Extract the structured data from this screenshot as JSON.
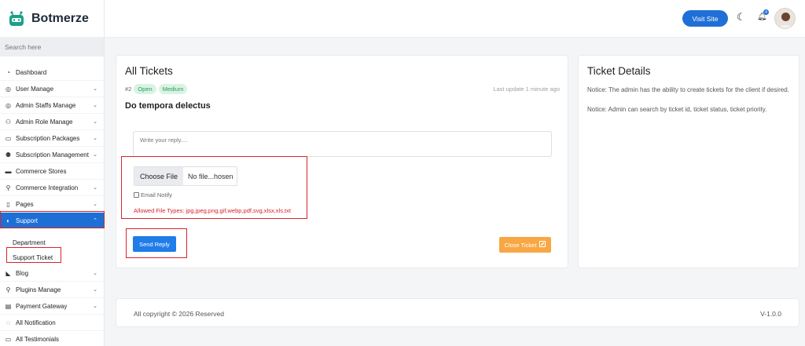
{
  "brand": {
    "name": "Botmerze"
  },
  "search": {
    "placeholder": "Search here"
  },
  "sidebar": {
    "items": [
      {
        "label": "Dashboard",
        "icon": "gauge-icon",
        "chev": false
      },
      {
        "label": "User Manage",
        "icon": "user-icon",
        "chev": true
      },
      {
        "label": "Admin Staffs Manage",
        "icon": "user-shield-icon",
        "chev": true
      },
      {
        "label": "Admin Role Manage",
        "icon": "users-icon",
        "chev": true
      },
      {
        "label": "Subscription Packages",
        "icon": "calendar-icon",
        "chev": true
      },
      {
        "label": "Subscription Management",
        "icon": "user-group-icon",
        "chev": true
      },
      {
        "label": "Commerce Stores",
        "icon": "card-icon",
        "chev": false
      },
      {
        "label": "Commerce Integration",
        "icon": "plug-icon",
        "chev": true
      },
      {
        "label": "Pages",
        "icon": "file-icon",
        "chev": true
      },
      {
        "label": "Support",
        "icon": "headset-icon",
        "chev": true,
        "active": true
      }
    ],
    "support_sub": [
      "Department",
      "Support Ticket"
    ],
    "items_after": [
      {
        "label": "Blog",
        "icon": "megaphone-icon",
        "chev": true
      },
      {
        "label": "Plugins Manage",
        "icon": "plug-icon",
        "chev": true
      },
      {
        "label": "Payment Gateway",
        "icon": "wallet-icon",
        "chev": true
      },
      {
        "label": "All Notification",
        "icon": "bell-icon",
        "chev": false
      },
      {
        "label": "All Testimonials",
        "icon": "chat-icon",
        "chev": false
      }
    ]
  },
  "topbar": {
    "visit_label": "Visit Site",
    "notification_count": "4"
  },
  "tickets": {
    "title": "All Tickets",
    "ticket_no": "#2",
    "status": "Open",
    "priority": "Medium",
    "last_update": "Last update 1 minute ago",
    "subject": "Do tempora delectus",
    "reply_placeholder": "Write your reply....",
    "choose_file": "Choose File",
    "file_name": "No file...hosen",
    "email_notify": "Email Notify",
    "allowed": "Allowed File Types: jpg,jpeg,png,gif,webp,pdf,svg,xlsx,xls,txt",
    "send_label": "Send Reply",
    "close_label": "Close Ticket"
  },
  "details": {
    "title": "Ticket Details",
    "notice1": "Notice: The admin has the ability to create tickets for the client if desired.",
    "notice2": "Notice: Admin can search by ticket id, ticket status, ticket priority."
  },
  "footer": {
    "copyright": "All copyright © 2026 Reserved",
    "version": "V-1.0.0"
  },
  "colors": {
    "primary": "#1f6fd6",
    "danger": "#d9232d",
    "warning": "#f7a844",
    "success": "#2c9c5b"
  }
}
